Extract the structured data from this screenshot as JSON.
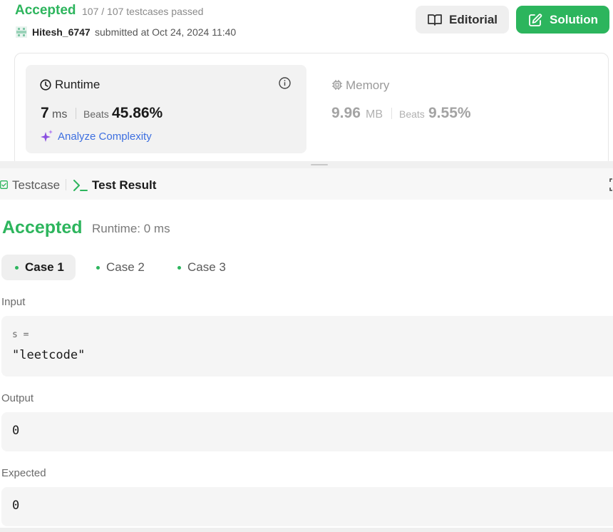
{
  "submission": {
    "status": "Accepted",
    "testcases_passed": "107 / 107 testcases passed",
    "user": "Hitesh_6747",
    "submitted_at": "submitted at Oct 24, 2024 11:40",
    "editorial_label": "Editorial",
    "solution_label": "Solution"
  },
  "performance": {
    "runtime_label": "Runtime",
    "runtime_value": "7",
    "runtime_unit": "ms",
    "runtime_beats_label": "Beats",
    "runtime_beats_value": "45.86%",
    "analyze_label": "Analyze Complexity",
    "memory_label": "Memory",
    "memory_value": "9.96",
    "memory_unit": "MB",
    "memory_beats_label": "Beats",
    "memory_beats_value": "9.55%"
  },
  "tabs": {
    "testcase_label": "Testcase",
    "result_label": "Test Result"
  },
  "test_result": {
    "status": "Accepted",
    "runtime": "Runtime: 0 ms",
    "cases": [
      "Case 1",
      "Case 2",
      "Case 3"
    ],
    "input_label": "Input",
    "input_var": "s =",
    "input_value": "\"leetcode\"",
    "output_label": "Output",
    "output_value": "0",
    "expected_label": "Expected",
    "expected_value": "0"
  },
  "colors": {
    "accepted": "#2db55d",
    "link": "#3d6fe0",
    "solution_button": "#2cb55d"
  },
  "icons": [
    "avatar-icon",
    "book-icon",
    "edit-icon",
    "clock-icon",
    "info-icon",
    "sparkle-icon",
    "chip-icon",
    "checkbox-icon",
    "terminal-icon",
    "expand-icon"
  ]
}
